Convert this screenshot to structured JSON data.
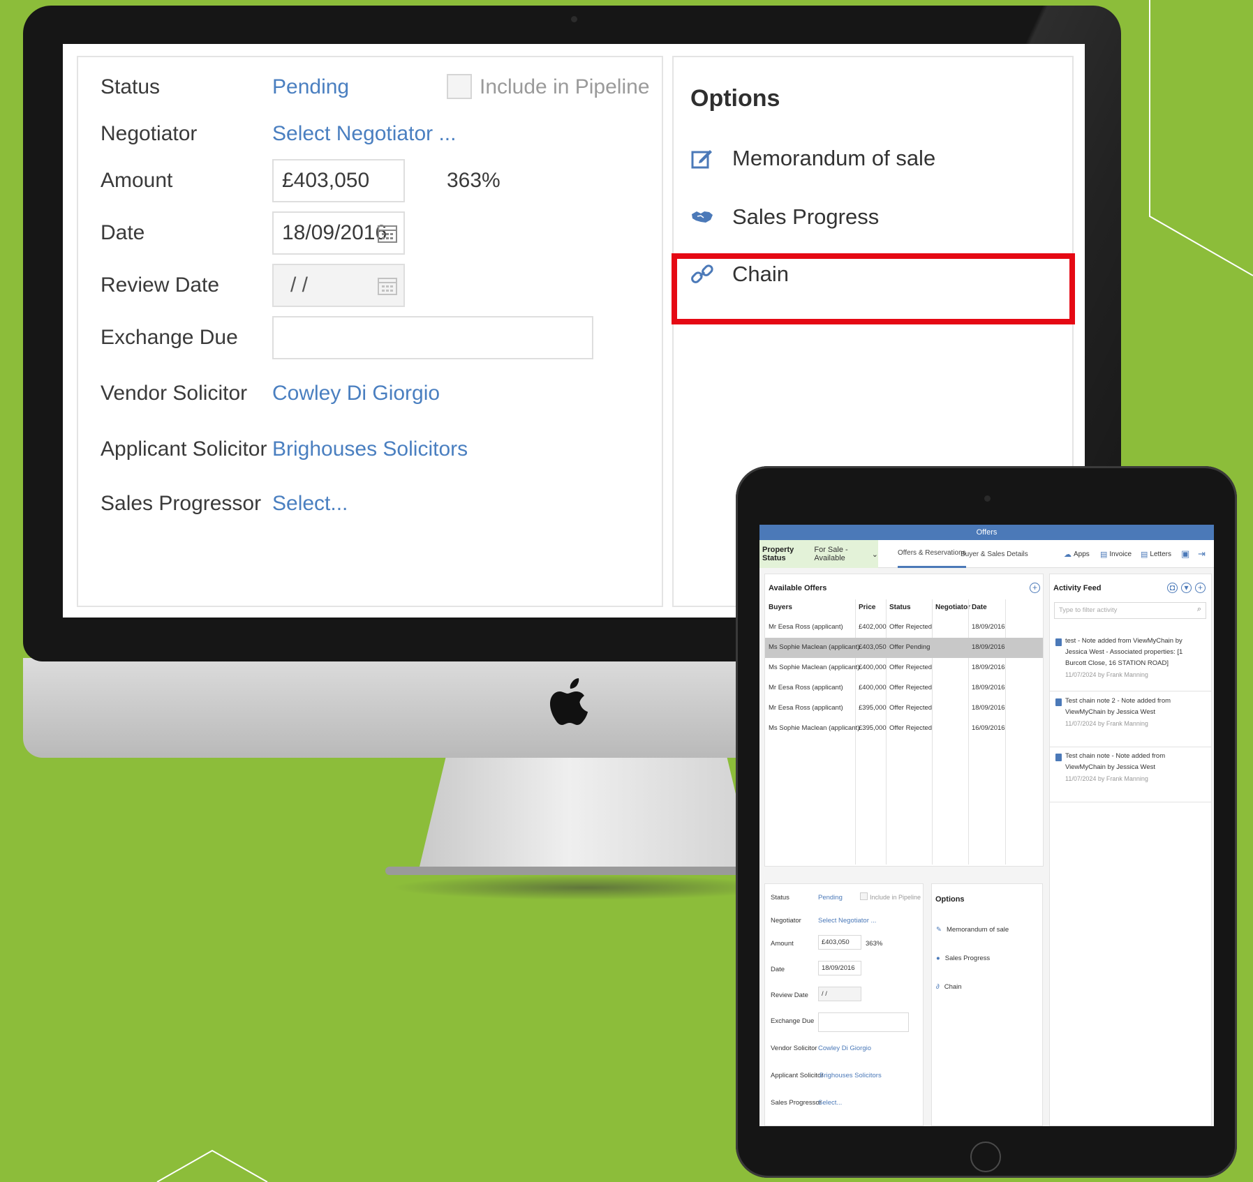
{
  "desktop": {
    "form": {
      "status_label": "Status",
      "status_value": "Pending",
      "include_pipeline_label": "Include in Pipeline",
      "include_pipeline_checked": false,
      "negotiator_label": "Negotiator",
      "negotiator_value": "Select Negotiator ...",
      "amount_label": "Amount",
      "amount_value": "£403,050",
      "amount_percent": "363%",
      "date_label": "Date",
      "date_value": "18/09/2016",
      "review_date_label": "Review Date",
      "review_date_value": "/ /",
      "exchange_due_label": "Exchange Due",
      "exchange_due_value": "",
      "vendor_solicitor_label": "Vendor Solicitor",
      "vendor_solicitor_value": "Cowley Di Giorgio",
      "applicant_solicitor_label": "Applicant Solicitor",
      "applicant_solicitor_value": "Brighouses Solicitors",
      "sales_progressor_label": "Sales Progressor",
      "sales_progressor_value": "Select..."
    },
    "options": {
      "title": "Options",
      "items": [
        {
          "label": "Memorandum of sale",
          "icon": "edit-icon"
        },
        {
          "label": "Sales Progress",
          "icon": "handshake-icon"
        },
        {
          "label": "Chain",
          "icon": "link-icon"
        }
      ],
      "highlighted": "Chain",
      "highlight_color": "#e50914"
    }
  },
  "tablet": {
    "title": "Offers",
    "property_status_label": "Property Status",
    "property_status_value": "For Sale - Available",
    "tabs": [
      "Offers & Reservations",
      "Buyer & Sales Details"
    ],
    "toolbar": [
      "Apps",
      "Invoice",
      "Letters"
    ],
    "available_offers": {
      "title": "Available Offers",
      "columns": [
        "Buyers",
        "Price",
        "Status",
        "Negotiator",
        "Date"
      ],
      "rows": [
        {
          "buyer": "Mr Eesa Ross (applicant)",
          "price": "£402,000",
          "status": "Offer Rejected",
          "negotiator": "",
          "date": "18/09/2016"
        },
        {
          "buyer": "Ms Sophie Maclean (applicant)",
          "price": "£403,050",
          "status": "Offer Pending",
          "negotiator": "",
          "date": "18/09/2016"
        },
        {
          "buyer": "Ms Sophie Maclean (applicant)",
          "price": "£400,000",
          "status": "Offer Rejected",
          "negotiator": "",
          "date": "18/09/2016"
        },
        {
          "buyer": "Mr Eesa Ross (applicant)",
          "price": "£400,000",
          "status": "Offer Rejected",
          "negotiator": "",
          "date": "18/09/2016"
        },
        {
          "buyer": "Mr Eesa Ross (applicant)",
          "price": "£395,000",
          "status": "Offer Rejected",
          "negotiator": "",
          "date": "18/09/2016"
        },
        {
          "buyer": "Ms Sophie Maclean (applicant)",
          "price": "£395,000",
          "status": "Offer Rejected",
          "negotiator": "",
          "date": "16/09/2016"
        }
      ]
    },
    "activity_feed": {
      "title": "Activity Feed",
      "filter_placeholder": "Type to filter activity",
      "items": [
        {
          "text": "test - Note added from ViewMyChain by Jessica West - Associated properties: [1 Burcott Close, 16 STATION ROAD]",
          "meta": "11/07/2024 by Frank Manning"
        },
        {
          "text": "Test chain note 2 - Note added from ViewMyChain by Jessica West",
          "meta": "11/07/2024 by Frank Manning"
        },
        {
          "text": "Test chain note - Note added from ViewMyChain by Jessica West",
          "meta": "11/07/2024 by Frank Manning"
        }
      ]
    },
    "form": {
      "status_label": "Status",
      "status_value": "Pending",
      "include_pipeline_label": "Include in Pipeline",
      "negotiator_label": "Negotiator",
      "negotiator_value": "Select Negotiator ...",
      "amount_label": "Amount",
      "amount_value": "£403,050",
      "amount_percent": "363%",
      "date_label": "Date",
      "date_value": "18/09/2016",
      "review_date_label": "Review Date",
      "review_date_value": "/ /",
      "exchange_due_label": "Exchange Due",
      "vendor_solicitor_label": "Vendor Solicitor",
      "vendor_solicitor_value": "Cowley Di Giorgio",
      "applicant_solicitor_label": "Applicant Solicitor",
      "applicant_solicitor_value": "Brighouses Solicitors",
      "sales_progressor_label": "Sales Progressor",
      "sales_progressor_value": "Select..."
    },
    "options": {
      "title": "Options",
      "items": [
        "Memorandum of sale",
        "Sales Progress",
        "Chain"
      ]
    }
  },
  "colors": {
    "background": "#8cbd3a",
    "link_blue": "#4a7fc0",
    "header_blue": "#4b79b8",
    "highlight_red": "#e50914"
  }
}
